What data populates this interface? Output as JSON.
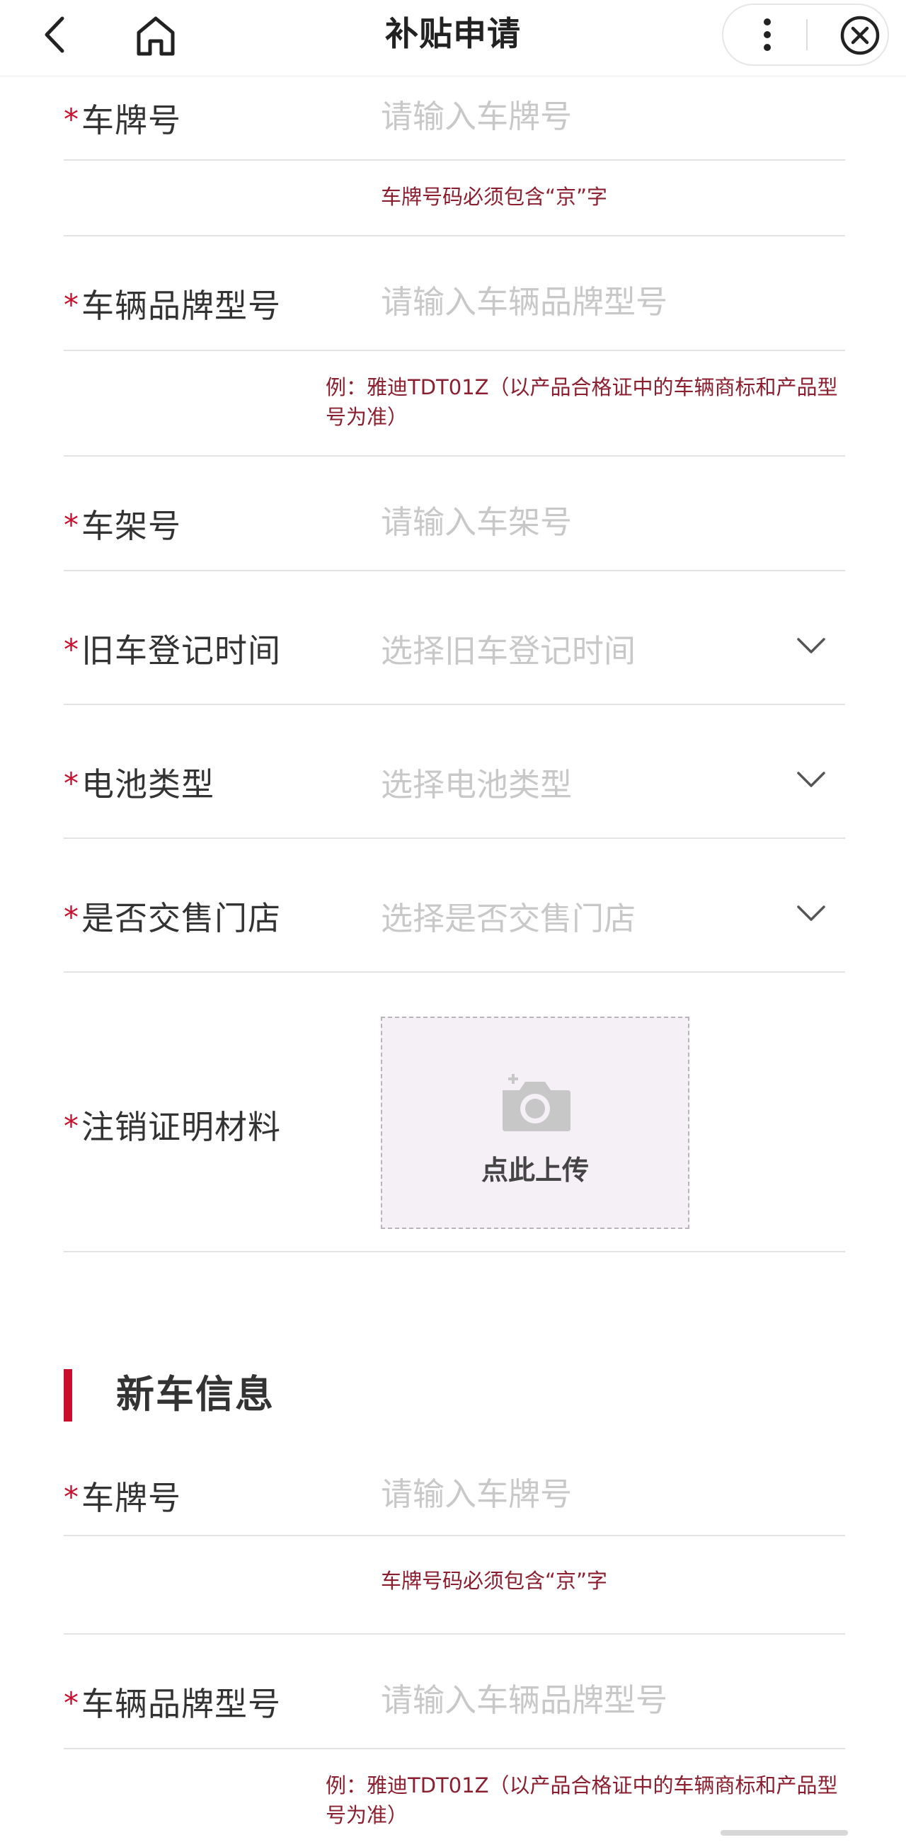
{
  "header": {
    "title": "补贴申请"
  },
  "old_car": {
    "plate": {
      "label": "车牌号",
      "placeholder": "请输入车牌号",
      "hint": "车牌号码必须包含“京”字"
    },
    "brand_model": {
      "label": "车辆品牌型号",
      "placeholder": "请输入车辆品牌型号",
      "hint": "例：雅迪TDT01Z（以产品合格证中的车辆商标和产品型号为准）"
    },
    "frame_no": {
      "label": "车架号",
      "placeholder": "请输入车架号"
    },
    "register_time": {
      "label": "旧车登记时间",
      "placeholder": "选择旧车登记时间"
    },
    "battery_type": {
      "label": "电池类型",
      "placeholder": "选择电池类型"
    },
    "sold_to_store": {
      "label": "是否交售门店",
      "placeholder": "选择是否交售门店"
    },
    "cancel_proof": {
      "label": "注销证明材料",
      "upload_label": "点此上传"
    }
  },
  "new_car": {
    "section_title": "新车信息",
    "plate": {
      "label": "车牌号",
      "placeholder": "请输入车牌号",
      "hint": "车牌号码必须包含“京”字"
    },
    "brand_model": {
      "label": "车辆品牌型号",
      "placeholder": "请输入车辆品牌型号",
      "hint": "例：雅迪TDT01Z（以产品合格证中的车辆商标和产品型号为准）"
    }
  },
  "required_mark": "*",
  "colors": {
    "accent": "#c8102e",
    "hint_text": "#8b1f2f",
    "placeholder": "#c8c8c8",
    "upload_bg": "#f5eff6"
  },
  "icons": {
    "back": "chevron-left-icon",
    "home": "home-icon",
    "more": "more-vertical-icon",
    "close": "close-circle-icon",
    "dropdown": "chevron-down-icon",
    "upload": "camera-plus-icon"
  }
}
